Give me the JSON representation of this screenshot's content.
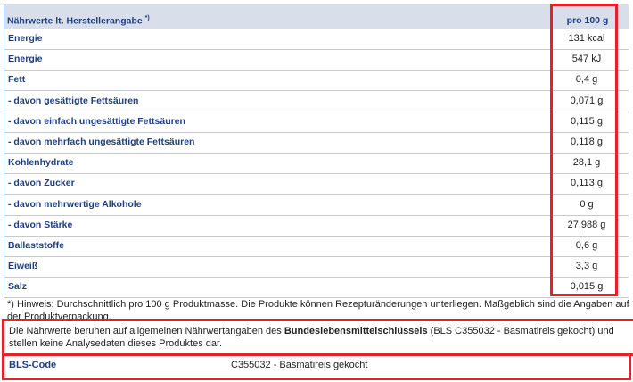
{
  "header": {
    "title": "Nährwerte lt. Herstellerangabe",
    "footnote_mark": "*)",
    "column": "pro 100 g"
  },
  "rows": [
    {
      "label": "Energie",
      "value": "131 kcal"
    },
    {
      "label": "Energie",
      "value": "547 kJ"
    },
    {
      "label": "Fett",
      "value": "0,4 g"
    },
    {
      "label": "- davon gesättigte Fettsäuren",
      "value": "0,071 g"
    },
    {
      "label": "- davon einfach ungesättigte Fettsäuren",
      "value": "0,115 g"
    },
    {
      "label": "- davon mehrfach ungesättigte Fettsäuren",
      "value": "0,118 g"
    },
    {
      "label": "Kohlenhydrate",
      "value": "28,1 g"
    },
    {
      "label": "- davon Zucker",
      "value": "0,113 g"
    },
    {
      "label": "- davon mehrwertige Alkohole",
      "value": "0 g"
    },
    {
      "label": "- davon Stärke",
      "value": "27,988 g"
    },
    {
      "label": "Ballaststoffe",
      "value": "0,6 g"
    },
    {
      "label": "Eiweiß",
      "value": "3,3 g"
    },
    {
      "label": "Salz",
      "value": "0,015 g"
    }
  ],
  "note": "*) Hinweis: Durchschnittlich pro 100 g Produktmasse. Die Produkte können Rezepturänderungen unterliegen. Maßgeblich sind die Angaben auf der Produktverpackung.",
  "bls_note": {
    "pre": "Die Nährwerte beruhen auf allgemeinen Nährwertangaben des ",
    "bold": "Bundeslebensmittelschlüssels",
    "post": " (BLS C355032 - Basmatireis gekocht) und stellen keine Analysedaten dieses Produktes dar."
  },
  "bls": {
    "label": "BLS-Code",
    "value": "C355032 - Basmatireis gekocht"
  },
  "colors": {
    "accent_red": "#e8202a",
    "label_blue": "#1f3f80",
    "header_bg": "#d8dfea"
  }
}
